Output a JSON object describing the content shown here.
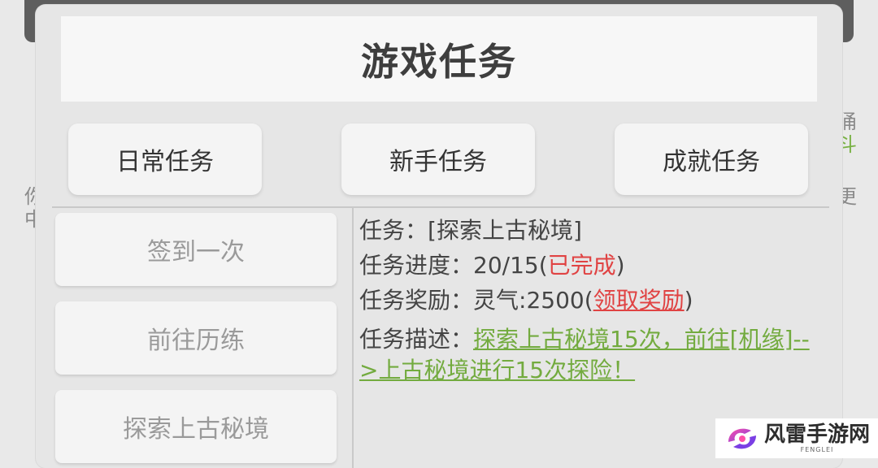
{
  "background": {
    "left_text": [
      "你",
      "中"
    ],
    "right_text": [
      "俑",
      "斗",
      "更"
    ]
  },
  "dialog": {
    "title": "游戏任务",
    "tabs": [
      {
        "label": "日常任务"
      },
      {
        "label": "新手任务"
      },
      {
        "label": "成就任务"
      }
    ],
    "task_list": [
      {
        "label": "签到一次"
      },
      {
        "label": "前往历练"
      },
      {
        "label": "探索上古秘境"
      }
    ],
    "detail": {
      "task_label": "任务：",
      "task_name": "[探索上古秘境]",
      "progress_label": "任务进度：",
      "progress_value": "20/15(",
      "progress_status": "已完成",
      "progress_close": ")",
      "reward_label": "任务奖励：",
      "reward_value": "灵气:2500(",
      "reward_link": "领取奖励",
      "reward_close": ")",
      "desc_label": "任务描述：",
      "desc_text": "探索上古秘境15次，前往[机缘]-->上古秘境进行15次探险！"
    }
  },
  "watermark": {
    "name": "风雷手游网",
    "sub": "FENGLEI"
  },
  "colors": {
    "accent_red": "#e04343",
    "accent_green": "#73ab3f"
  }
}
